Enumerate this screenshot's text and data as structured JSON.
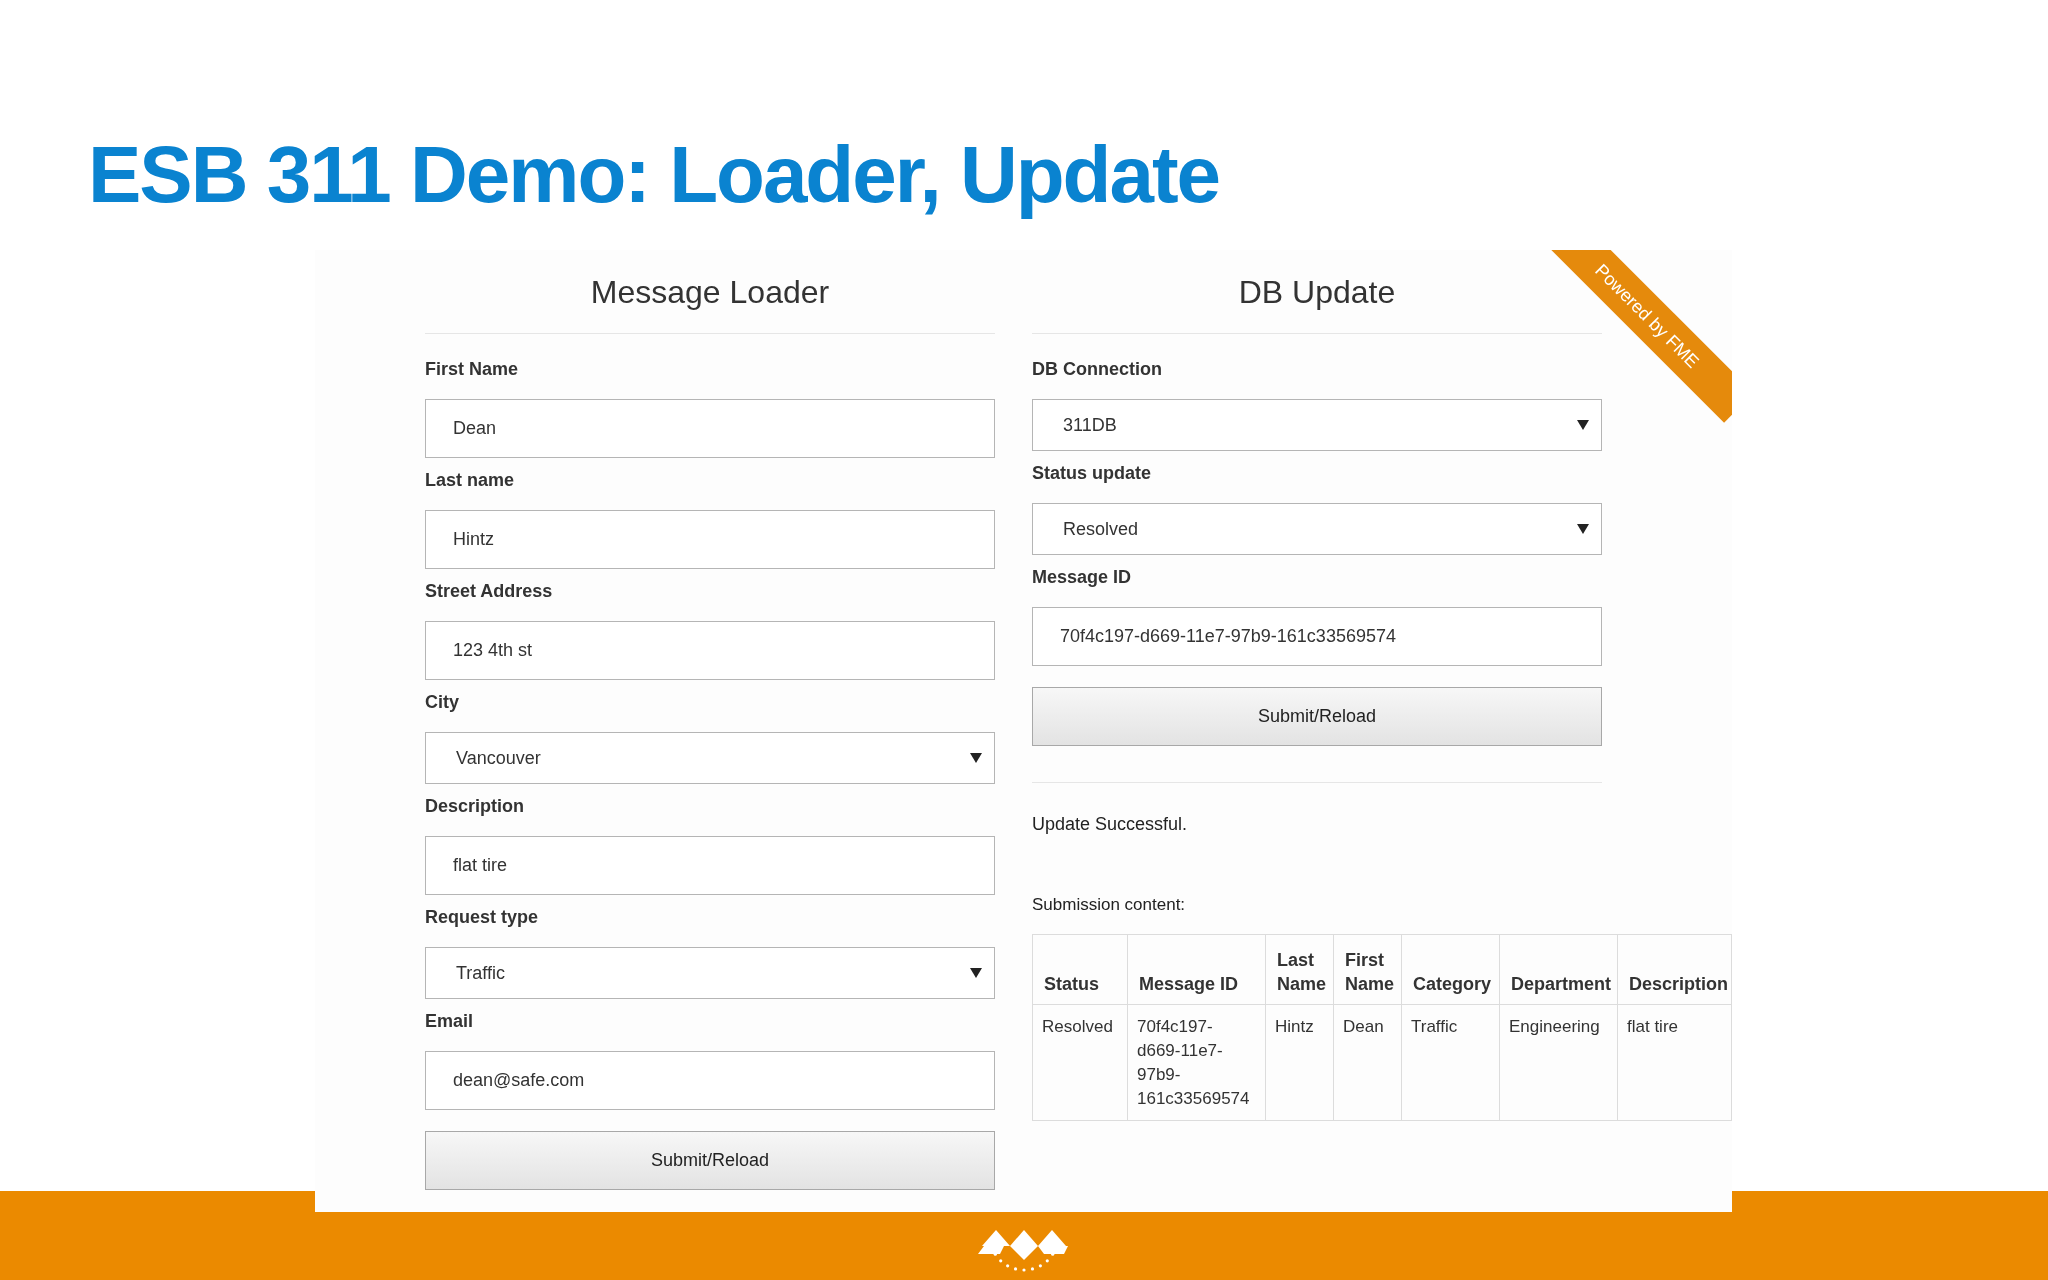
{
  "title": "ESB 311 Demo: Loader, Update",
  "loader": {
    "heading": "Message Loader",
    "fields": [
      {
        "label": "First Name",
        "kind": "text",
        "value": "Dean"
      },
      {
        "label": "Last name",
        "kind": "text",
        "value": "Hintz"
      },
      {
        "label": "Street Address",
        "kind": "text",
        "value": "123 4th st"
      },
      {
        "label": "City",
        "kind": "select",
        "value": "Vancouver"
      },
      {
        "label": "Description",
        "kind": "text",
        "value": "flat tire"
      },
      {
        "label": "Request type",
        "kind": "select",
        "value": "Traffic"
      },
      {
        "label": "Email",
        "kind": "text",
        "value": "dean@safe.com"
      }
    ],
    "button": "Submit/Reload"
  },
  "update": {
    "heading": "DB Update",
    "fields": [
      {
        "label": "DB Connection",
        "kind": "select",
        "value": "311DB"
      },
      {
        "label": "Status update",
        "kind": "select",
        "value": "Resolved"
      },
      {
        "label": "Message ID",
        "kind": "text",
        "value": "70f4c197-d669-11e7-97b9-161c33569574"
      }
    ],
    "button": "Submit/Reload",
    "result": "Update Successful.",
    "submission_label": "Submission content:",
    "table": {
      "columns": [
        "Status",
        "Message ID",
        "Last Name",
        "First Name",
        "Category",
        "Department",
        "Description"
      ],
      "rows": [
        [
          "Resolved",
          "70f4c197-d669-11e7-97b9-161c33569574",
          "Hintz",
          "Dean",
          "Traffic",
          "Engineering",
          "flat tire"
        ]
      ]
    }
  },
  "ribbon": "Powered by FME"
}
